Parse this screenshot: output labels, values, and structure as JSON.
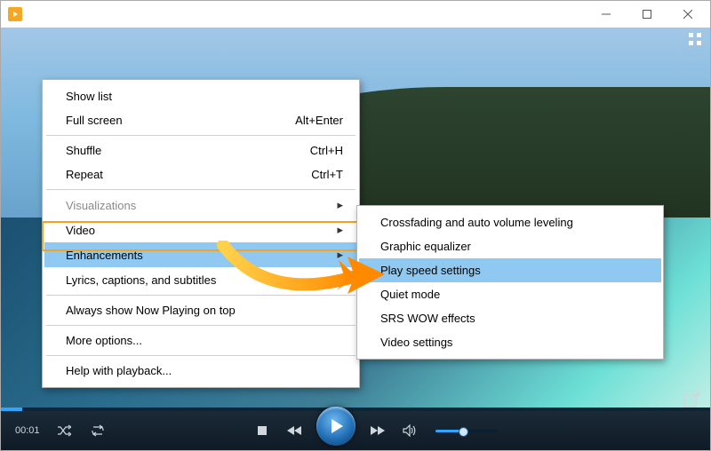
{
  "titlebar": {
    "app_title": ""
  },
  "menu": {
    "main": {
      "show_list": "Show list",
      "full_screen": {
        "label": "Full screen",
        "accel": "Alt+Enter"
      },
      "shuffle": {
        "label": "Shuffle",
        "accel": "Ctrl+H"
      },
      "repeat": {
        "label": "Repeat",
        "accel": "Ctrl+T"
      },
      "visualizations": "Visualizations",
      "video": "Video",
      "enhancements": "Enhancements",
      "lyrics": "Lyrics, captions, and subtitles",
      "always_top": "Always show Now Playing on top",
      "more_options": "More options...",
      "help_playback": "Help with playback..."
    },
    "enh_sub": {
      "crossfading": "Crossfading and auto volume leveling",
      "graphic_eq": "Graphic equalizer",
      "play_speed": "Play speed settings",
      "quiet_mode": "Quiet mode",
      "srs_wow": "SRS WOW effects",
      "video_settings": "Video settings"
    }
  },
  "playback": {
    "elapsed": "00:01"
  }
}
